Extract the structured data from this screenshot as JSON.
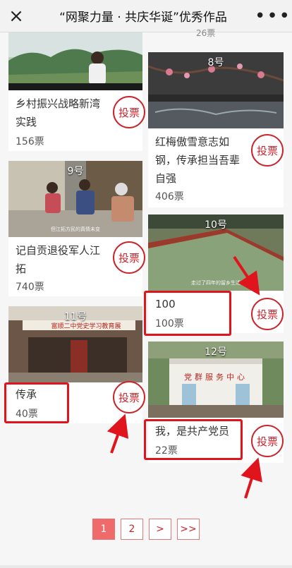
{
  "header": {
    "close_icon": "×",
    "title": "“网聚力量 · 共庆华诞”优秀作品",
    "more_icon": "•••"
  },
  "cards": [
    {
      "number": "",
      "title": "乡村振兴战略新湾实践",
      "votes": "156票",
      "vote_label": "投票"
    },
    {
      "number": "8号",
      "title": "红梅傲雪意志如钢，传承担当吾辈自强",
      "votes": "406票",
      "vote_label": "投票"
    },
    {
      "number": "9号",
      "title": "记自贡退役军人江拓",
      "votes": "740票",
      "vote_label": "投票",
      "thumb_caption": "但江拓方民的真情未变"
    },
    {
      "number": "10号",
      "title": "100",
      "votes": "100票",
      "vote_label": "投票",
      "thumb_caption": "走过了四年的留乡生活"
    },
    {
      "number": "11号",
      "title": "传承",
      "votes": "40票",
      "vote_label": "投票",
      "thumb_caption": "富顺二中党史学习教育展"
    },
    {
      "number": "12号",
      "title": "我，是共产党员",
      "votes": "22票",
      "vote_label": "投票",
      "thumb_caption": "党群服务中心"
    }
  ],
  "top_partial_votes": "26票",
  "pagination": {
    "pages": [
      "1",
      "2"
    ],
    "next": ">",
    "last": ">>",
    "active": "1"
  },
  "colors": {
    "accent": "#c9252c",
    "annotation": "#e0141c"
  }
}
